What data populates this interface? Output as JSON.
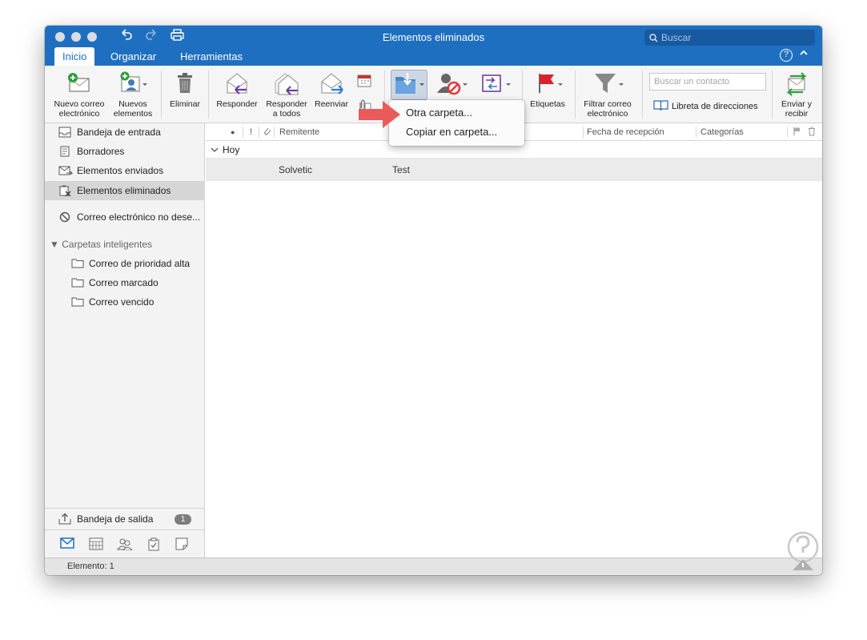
{
  "window": {
    "title": "Elementos eliminados",
    "search_placeholder": "Buscar"
  },
  "tabs": [
    "Inicio",
    "Organizar",
    "Herramientas"
  ],
  "ribbon": {
    "new_email": [
      "Nuevo correo",
      "electrónico"
    ],
    "new_items": [
      "Nuevos",
      "elementos"
    ],
    "delete": "Eliminar",
    "reply": "Responder",
    "reply_all": [
      "Responder",
      "a todos"
    ],
    "forward": "Reenviar",
    "tags": "Etiquetas",
    "filter_email": [
      "Filtrar correo",
      "electrónico"
    ],
    "contact_search_placeholder": "Buscar un contacto",
    "address_book": "Libreta de direcciones",
    "send_receive": [
      "Enviar y",
      "recibir"
    ]
  },
  "move_menu": {
    "items": [
      "Otra carpeta...",
      "Copiar en carpeta..."
    ]
  },
  "sidebar": {
    "folders": [
      {
        "label": "Bandeja de entrada",
        "icon": "inbox-icon"
      },
      {
        "label": "Borradores",
        "icon": "drafts-icon"
      },
      {
        "label": "Elementos enviados",
        "icon": "sent-icon"
      },
      {
        "label": "Elementos eliminados",
        "icon": "trash-icon",
        "selected": true
      },
      {
        "label": "Correo electrónico no dese...",
        "icon": "junk-icon"
      }
    ],
    "smart_folders_header": "Carpetas inteligentes",
    "smart_folders": [
      "Correo de prioridad alta",
      "Correo marcado",
      "Correo vencido"
    ],
    "outbox": {
      "label": "Bandeja de salida",
      "count": "1"
    }
  },
  "maillist": {
    "columns": {
      "sender": "Remitente",
      "received": "Fecha de recepción",
      "categories": "Categorías"
    },
    "group": "Hoy",
    "messages": [
      {
        "sender": "Solvetic",
        "subject": "Test"
      }
    ]
  },
  "status": {
    "text": "Elemento: 1"
  },
  "colors": {
    "accent": "#1f6fc1",
    "arrow": "#ea5a5a"
  }
}
